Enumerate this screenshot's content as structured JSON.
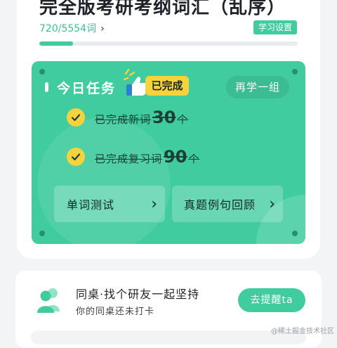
{
  "vocab": {
    "book_title": "完全版考研考纲词汇（乱序）",
    "progress_text": "720/5554词",
    "progress_fraction": 0.1296,
    "settings_label": "学习设置"
  },
  "task": {
    "title": "今日任务",
    "done_badge": "已完成",
    "relearn_label": "再学一组",
    "items": [
      {
        "prefix": "已完成新词",
        "count": "30",
        "unit": "个"
      },
      {
        "prefix": "已完成复习词",
        "count": "90",
        "unit": "个"
      }
    ],
    "buttons": [
      {
        "label": "单词测试"
      },
      {
        "label": "真题例句回顾"
      }
    ]
  },
  "partner": {
    "title": "同桌·找个研友一起坚持",
    "subtitle": "你的同桌还未打卡",
    "remind_label": "去提醒ta"
  },
  "watermark": "@稀土掘金技术社区",
  "colors": {
    "accent": "#40cc9f",
    "badge": "#f6d23d",
    "background": "#f3f4f6"
  },
  "icons": [
    "chevron-right-icon",
    "thumbs-up-icon",
    "check-icon",
    "partner-icon"
  ]
}
